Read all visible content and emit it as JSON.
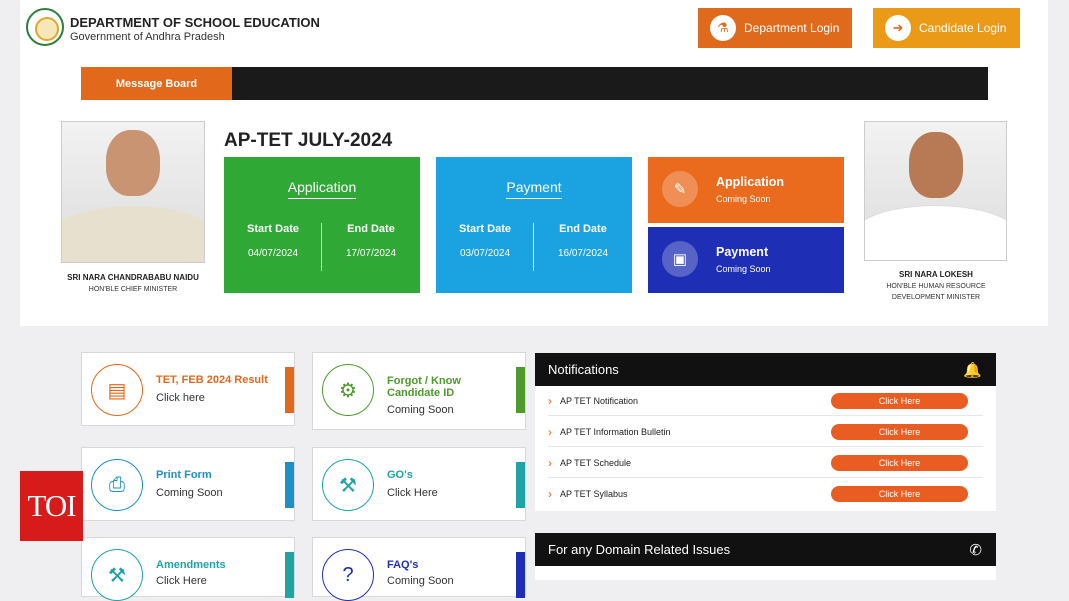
{
  "header": {
    "title": "DEPARTMENT OF SCHOOL EDUCATION",
    "subtitle": "Government of Andhra Pradesh",
    "department_login": "Department Login",
    "candidate_login": "Candidate Login"
  },
  "message_board": {
    "label": "Message Board"
  },
  "left_person": {
    "name": "SRI NARA CHANDRABABU NAIDU",
    "title": "HON'BLE CHIEF MINISTER"
  },
  "right_person": {
    "name": "SRI NARA LOKESH",
    "title_line1": "HON'BLE HUMAN RESOURCE",
    "title_line2": "DEVELOPMENT MINISTER"
  },
  "exam_title": "AP-TET JULY-2024",
  "application_card": {
    "title": "Application",
    "start_label": "Start Date",
    "end_label": "End Date",
    "start": "04/07/2024",
    "end": "17/07/2024",
    "color": "#2fa836"
  },
  "payment_card": {
    "title": "Payment",
    "start_label": "Start Date",
    "end_label": "End Date",
    "start": "03/07/2024",
    "end": "16/07/2024",
    "color": "#1aa3e0"
  },
  "status_cards": [
    {
      "title": "Application",
      "status": "Coming Soon",
      "color": "#ea6a1e"
    },
    {
      "title": "Payment",
      "status": "Coming Soon",
      "color": "#1f2fb5"
    }
  ],
  "quick_links": [
    {
      "title": "TET, FEB 2024 Result",
      "sub": "Click here",
      "color": "#e2681c",
      "icon": "result-icon"
    },
    {
      "title_line1": "Forgot / Know",
      "title_line2": "Candidate ID",
      "sub": "Coming Soon",
      "color": "#4e9a2c",
      "icon": "candidate-icon"
    },
    {
      "title": "Print Form",
      "sub": "Coming Soon",
      "color": "#1f8fc4",
      "icon": "printer-icon"
    },
    {
      "title": "GO's",
      "sub": "Click Here",
      "color": "#1fa3a3",
      "icon": "gavel-icon"
    },
    {
      "title": "Amendments",
      "sub": "Click Here",
      "color": "#1fa3a3",
      "icon": "amend-icon"
    },
    {
      "title": "FAQ's",
      "sub": "Coming Soon",
      "color": "#1f2fb5",
      "icon": "faq-icon"
    }
  ],
  "notifications": {
    "title": "Notifications",
    "items": [
      {
        "label": "AP TET Notification",
        "button": "Click Here"
      },
      {
        "label": "AP TET Information Bulletin",
        "button": "Click Here"
      },
      {
        "label": "AP TET Schedule",
        "button": "Click Here"
      },
      {
        "label": "AP TET Syllabus",
        "button": "Click Here"
      }
    ]
  },
  "domain_issues": {
    "title": "For any Domain Related Issues"
  },
  "watermark": "TOI"
}
